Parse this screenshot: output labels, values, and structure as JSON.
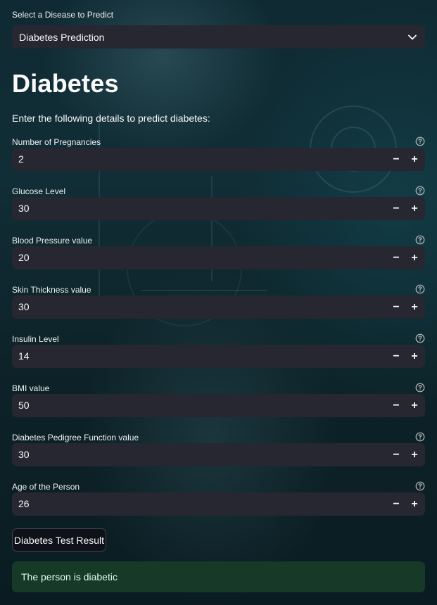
{
  "disease_select": {
    "label": "Select a Disease to Predict",
    "value": "Diabetes Prediction"
  },
  "page": {
    "title": "Diabetes",
    "subtitle": "Enter the following details to predict diabetes:"
  },
  "fields": [
    {
      "label": "Number of Pregnancies",
      "value": "2"
    },
    {
      "label": "Glucose Level",
      "value": "30"
    },
    {
      "label": "Blood Pressure value",
      "value": "20"
    },
    {
      "label": "Skin Thickness value",
      "value": "30"
    },
    {
      "label": "Insulin Level",
      "value": "14"
    },
    {
      "label": "BMI value",
      "value": "50"
    },
    {
      "label": "Diabetes Pedigree Function value",
      "value": "30"
    },
    {
      "label": "Age of the Person",
      "value": "26"
    }
  ],
  "stepper": {
    "minus": "−",
    "plus": "+"
  },
  "result_button": {
    "label": "Diabetes Test Result"
  },
  "result": {
    "message": "The person is diabetic"
  },
  "colors": {
    "input_bg": "#262730",
    "success_bg": "#173928",
    "success_text": "#dffde9",
    "text": "#fafafa"
  },
  "icons": {
    "select": "chevron-down-icon",
    "help": "question-circle-icon"
  }
}
